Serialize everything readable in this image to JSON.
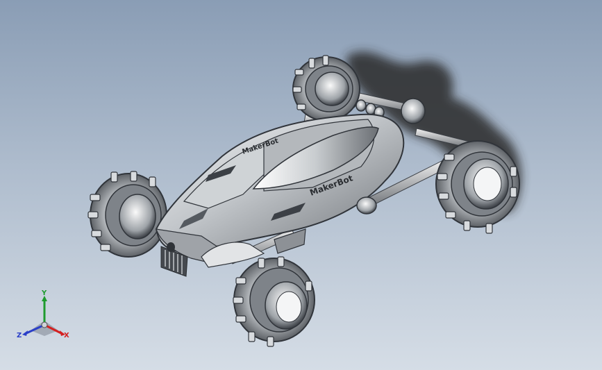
{
  "model": {
    "body_text_top": "MakerBot",
    "body_text_side": "MakerBot"
  },
  "triad": {
    "x_label": "X",
    "y_label": "Y",
    "z_label": "Z",
    "x_color": "#d42020",
    "y_color": "#1e9b2e",
    "z_color": "#2a3fc8"
  },
  "colors": {
    "bg_top": "#8a9db5",
    "bg_bottom": "#d5dde6",
    "metal_light": "#e4e6e8",
    "metal_mid": "#a9adb2",
    "metal_dark": "#4a4e54",
    "shadow": "#2a2a2a"
  }
}
